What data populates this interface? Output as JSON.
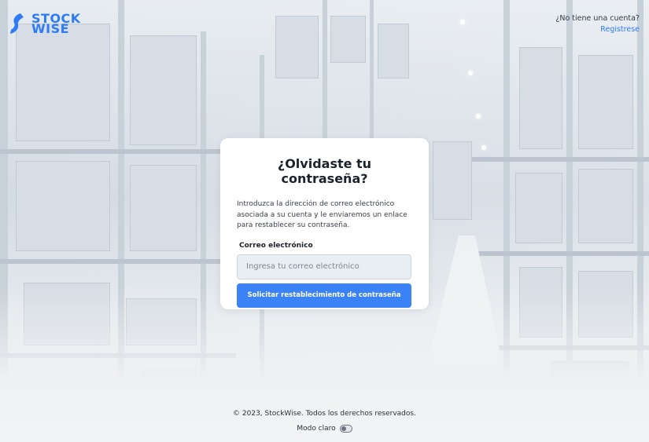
{
  "brand": {
    "line1": "STOCK",
    "line2": "WISE",
    "accent_color": "#2f7bf5"
  },
  "header": {
    "signup_question": "¿No tiene una cuenta?",
    "signup_link": "Registrese"
  },
  "form": {
    "title": "¿Olvidaste tu contraseña?",
    "description": "Introduzca la dirección de correo electrónico asociada a su cuenta y le enviaremos un enlace para restablecer su contraseña.",
    "email_label": "Correo electrónico",
    "email_value": "",
    "email_placeholder": "Ingresa tu correo electrónico",
    "submit_label": "Solicitar restablecimiento de contraseña",
    "button_color": "#3b82f6"
  },
  "footer": {
    "copyright": "© 2023, StockWise. Todos los derechos reservados.",
    "mode_label": "Modo claro",
    "mode_toggle_on": false
  },
  "icons": {
    "logo": "stockwise-logo-icon",
    "toggle": "theme-toggle-icon"
  }
}
